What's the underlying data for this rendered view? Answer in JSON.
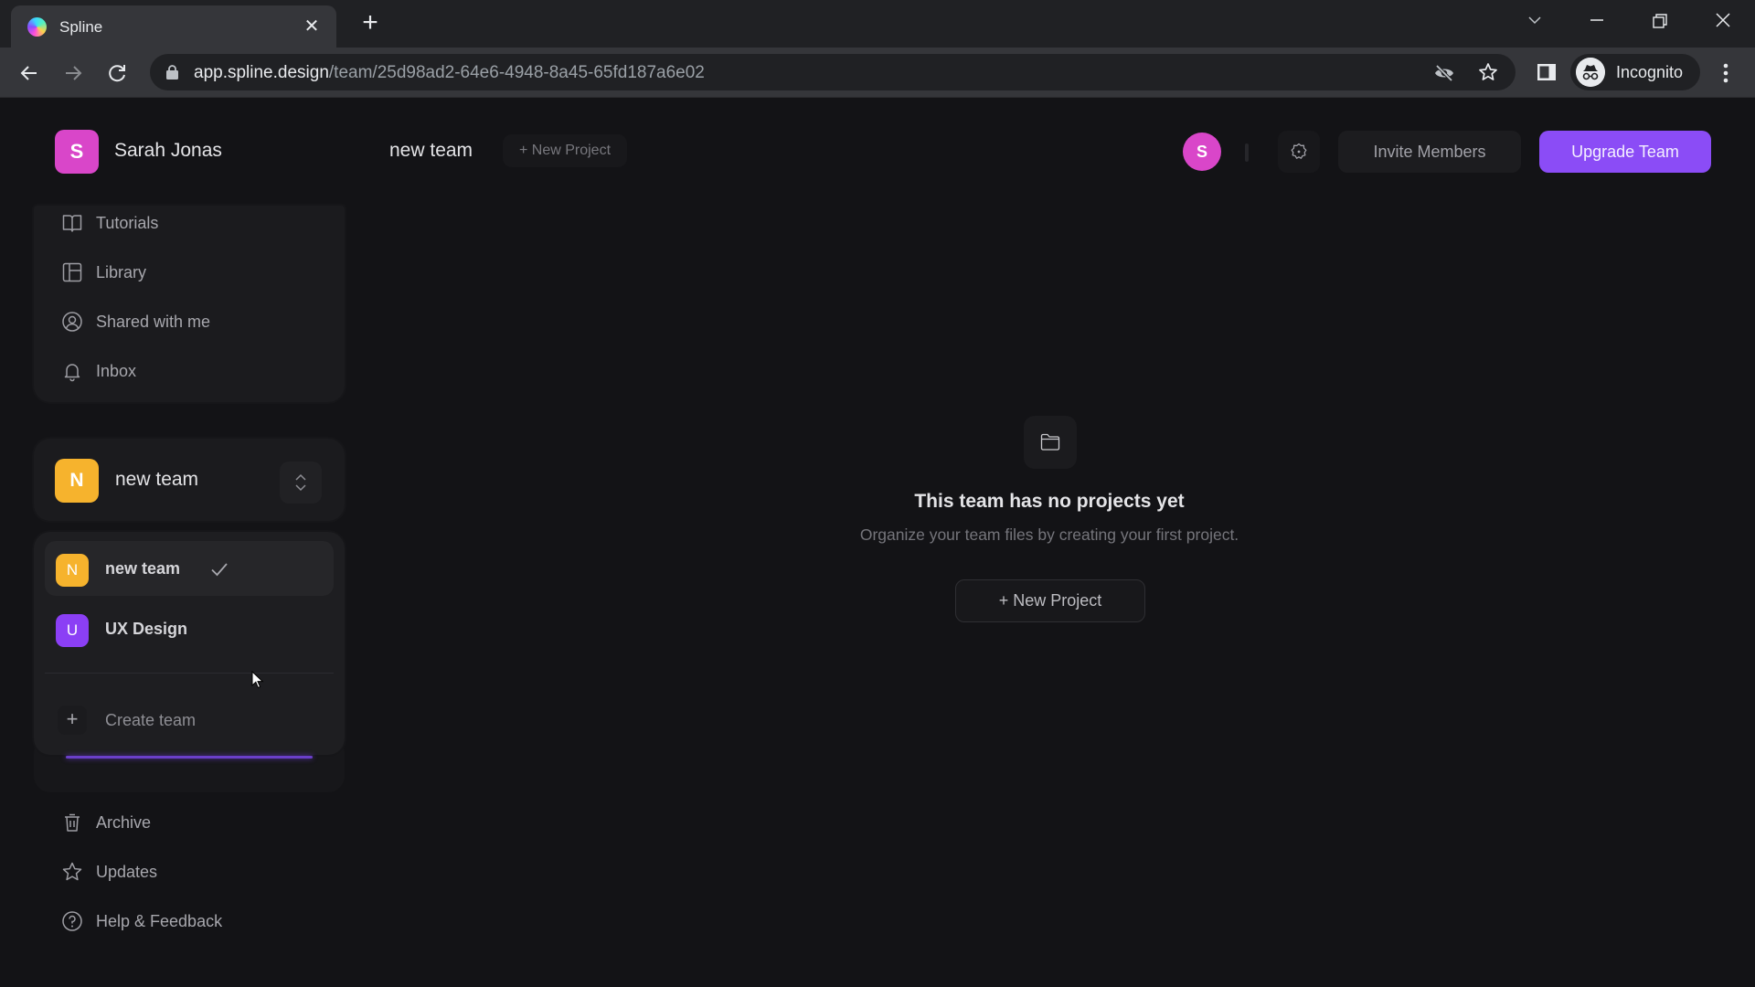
{
  "browser": {
    "tab_title": "Spline",
    "url_host": "app.spline.design",
    "url_path": "/team/25d98ad2-64e6-4948-8a45-65fd187a6e02",
    "profile_label": "Incognito"
  },
  "header": {
    "user_initial": "S",
    "user_name": "Sarah Jonas",
    "page_title": "new team",
    "new_project_chip": "+ New Project",
    "member_avatar_initial": "S",
    "invite_label": "Invite Members",
    "upgrade_label": "Upgrade Team"
  },
  "sidebar": {
    "nav_items": [
      {
        "label": "Tutorials",
        "icon": "book-icon"
      },
      {
        "label": "Library",
        "icon": "library-icon"
      },
      {
        "label": "Shared with me",
        "icon": "user-circle-icon"
      },
      {
        "label": "Inbox",
        "icon": "bell-icon"
      }
    ],
    "current_team": {
      "initial": "N",
      "name": "new team"
    },
    "team_dropdown": {
      "teams": [
        {
          "initial": "N",
          "name": "new team",
          "selected": true,
          "color": "#f6b32d"
        },
        {
          "initial": "U",
          "name": "UX Design",
          "selected": false,
          "color": "#8b3ff5"
        }
      ],
      "create_label": "Create team"
    },
    "bottom_items": [
      {
        "label": "Archive",
        "icon": "trash-icon"
      },
      {
        "label": "Updates",
        "icon": "star-icon"
      },
      {
        "label": "Help & Feedback",
        "icon": "help-circle-icon"
      }
    ]
  },
  "empty_state": {
    "title": "This team has no projects yet",
    "subtitle": "Organize your team files by creating your first project.",
    "button_label": "+ New Project"
  },
  "colors": {
    "accent": "#8b4cf6",
    "user_avatar": "#d946c9",
    "team_new": "#f6b32d",
    "team_ux": "#8b3ff5"
  }
}
